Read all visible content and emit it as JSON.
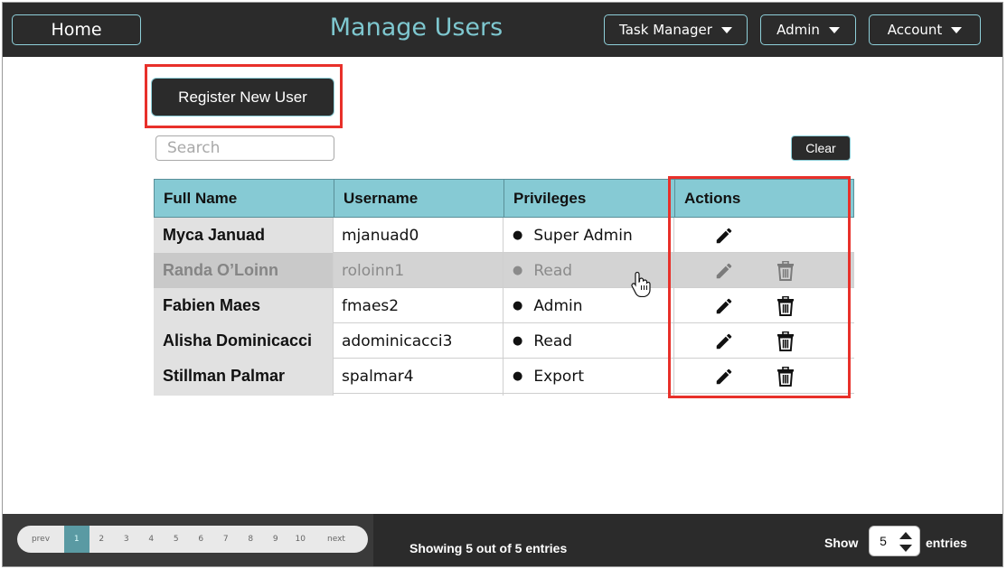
{
  "header": {
    "home_label": "Home",
    "title": "Manage Users",
    "menus": [
      {
        "label": "Task Manager"
      },
      {
        "label": "Admin"
      },
      {
        "label": "Account"
      }
    ]
  },
  "toolbar": {
    "register_label": "Register New User",
    "search_placeholder": "Search",
    "clear_label": "Clear"
  },
  "table": {
    "columns": [
      "Full Name",
      "Username",
      "Privileges",
      "Actions"
    ],
    "rows": [
      {
        "full_name": "Myca Januad",
        "username": "mjanuad0",
        "privilege": "Super Admin",
        "actions": [
          "edit-icon"
        ]
      },
      {
        "full_name": "Randa O’Loinn",
        "username": "roloinn1",
        "privilege": "Read",
        "actions": [
          "edit-icon",
          "trash-icon"
        ]
      },
      {
        "full_name": "Fabien Maes",
        "username": "fmaes2",
        "privilege": "Admin",
        "actions": [
          "edit-icon",
          "trash-icon"
        ]
      },
      {
        "full_name": "Alisha Dominicacci",
        "username": "adominicacci3",
        "privilege": "Read",
        "actions": [
          "edit-icon",
          "trash-icon"
        ]
      },
      {
        "full_name": "Stillman Palmar",
        "username": "spalmar4",
        "privilege": "Export",
        "actions": [
          "edit-icon",
          "trash-icon"
        ]
      }
    ]
  },
  "footer": {
    "pagination": {
      "prev_label": "prev",
      "next_label": "next",
      "pages": [
        "1",
        "2",
        "3",
        "4",
        "5",
        "6",
        "7",
        "8",
        "9",
        "10"
      ],
      "active_page": "1"
    },
    "showing_text": "Showing 5 out of 5 entries",
    "show_label": "Show",
    "entries_value": "5",
    "entries_label": "entries"
  },
  "colors": {
    "dark": "#2b2b2b",
    "accent": "#86cad4",
    "title": "#7ec7cf",
    "highlight": "#e8302a"
  }
}
